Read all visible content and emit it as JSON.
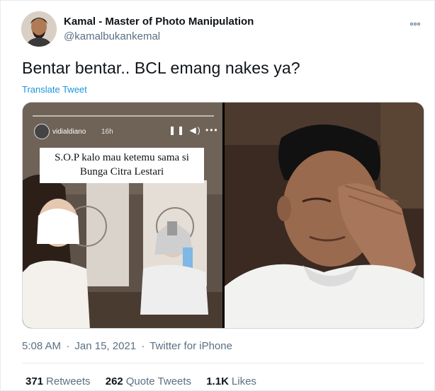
{
  "author": {
    "name": "Kamal - Master of Photo Manipulation",
    "handle": "@kamalbukankemal"
  },
  "icons": {
    "more": "more-options-icon",
    "avatar": "user-avatar"
  },
  "tweet": {
    "text": "Bentar bentar.. BCL emang nakes ya?",
    "translate_label": "Translate Tweet"
  },
  "media": {
    "left": {
      "story_user": "vidialdiano",
      "story_time": "16h",
      "story_controls": "❚❚ ◀) •••",
      "caption_line1": "S.O.P kalo mau ketemu sama si",
      "caption_line2": "Bunga Citra Lestari"
    }
  },
  "meta": {
    "time": "5:08 AM",
    "sep1": "·",
    "date": "Jan 15, 2021",
    "sep2": "·",
    "client": "Twitter for iPhone"
  },
  "stats": {
    "retweets_count": "371",
    "retweets_label": "Retweets",
    "quotes_count": "262",
    "quotes_label": "Quote Tweets",
    "likes_count": "1.1K",
    "likes_label": "Likes"
  },
  "colors": {
    "link": "#1b95e0",
    "secondary_text": "#5b7083",
    "primary_text": "#0f1419",
    "border": "#e6ecf0"
  }
}
